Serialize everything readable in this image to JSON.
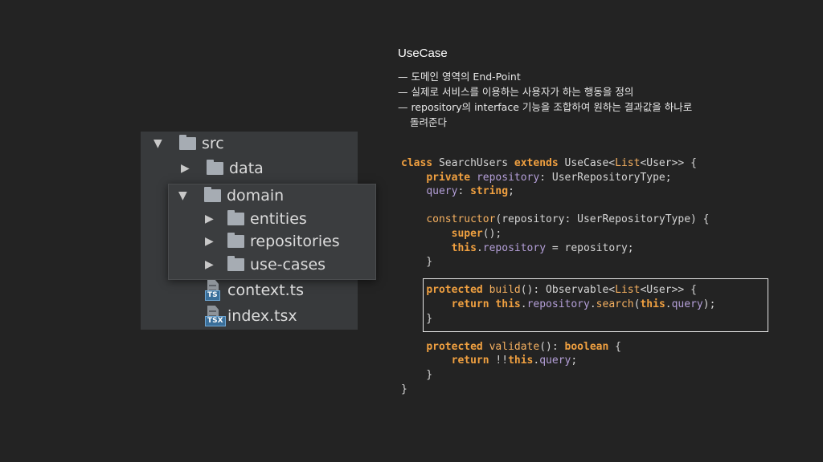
{
  "tree": {
    "items": [
      {
        "label": "src",
        "arrow": "▼",
        "icon": "folder-icon"
      },
      {
        "label": "data",
        "arrow": "▶",
        "icon": "folder-icon"
      },
      {
        "label": "domain",
        "arrow": "▼",
        "icon": "folder-icon"
      },
      {
        "label": "entities",
        "arrow": "▶",
        "icon": "folder-icon"
      },
      {
        "label": "repositories",
        "arrow": "▶",
        "icon": "folder-icon"
      },
      {
        "label": "use-cases",
        "arrow": "▶",
        "icon": "folder-icon"
      },
      {
        "label": "context.ts",
        "icon": "ts-file-icon",
        "tag": "TS"
      },
      {
        "label": "index.tsx",
        "icon": "tsx-file-icon",
        "tag": "TSX"
      }
    ]
  },
  "notes": {
    "title": "UseCase",
    "lines": [
      "— 도메인 영역의 End-Point",
      "— 실제로 서비스를 이용하는 사용자가 하는 행동을 정의",
      "— repository의 interface 기능을 조합하여 원하는 결과값을 하나로",
      "돌려준다"
    ]
  },
  "code": {
    "lines": [
      [
        [
          "kw",
          "class"
        ],
        [
          "t",
          " SearchUsers "
        ],
        [
          "kw",
          "extends"
        ],
        [
          "t",
          " UseCase<"
        ],
        [
          "fn",
          "List"
        ],
        [
          "t",
          "<User>> {"
        ]
      ],
      [
        [
          "t",
          "    "
        ],
        [
          "kw",
          "private"
        ],
        [
          "t",
          " "
        ],
        [
          "prop",
          "repository"
        ],
        [
          "t",
          ": UserRepositoryType;"
        ]
      ],
      [
        [
          "t",
          "    "
        ],
        [
          "prop",
          "query"
        ],
        [
          "t",
          ": "
        ],
        [
          "kw",
          "string"
        ],
        [
          "t",
          ";"
        ]
      ],
      [
        [
          "t",
          ""
        ]
      ],
      [
        [
          "t",
          "    "
        ],
        [
          "fn",
          "constructor"
        ],
        [
          "t",
          "(repository: UserRepositoryType) {"
        ]
      ],
      [
        [
          "t",
          "        "
        ],
        [
          "kw",
          "super"
        ],
        [
          "t",
          "();"
        ]
      ],
      [
        [
          "t",
          "        "
        ],
        [
          "kw",
          "this"
        ],
        [
          "t",
          "."
        ],
        [
          "prop",
          "repository"
        ],
        [
          "t",
          " = repository;"
        ]
      ],
      [
        [
          "t",
          "    }"
        ]
      ],
      [
        [
          "t",
          ""
        ]
      ],
      [
        [
          "t",
          "    "
        ],
        [
          "kw",
          "protected"
        ],
        [
          "t",
          " "
        ],
        [
          "fn",
          "build"
        ],
        [
          "t",
          "(): Observable<"
        ],
        [
          "fn",
          "List"
        ],
        [
          "t",
          "<User>> {"
        ]
      ],
      [
        [
          "t",
          "        "
        ],
        [
          "kw",
          "return"
        ],
        [
          "t",
          " "
        ],
        [
          "kw",
          "this"
        ],
        [
          "t",
          "."
        ],
        [
          "prop",
          "repository"
        ],
        [
          "t",
          "."
        ],
        [
          "fn",
          "search"
        ],
        [
          "t",
          "("
        ],
        [
          "kw",
          "this"
        ],
        [
          "t",
          "."
        ],
        [
          "prop",
          "query"
        ],
        [
          "t",
          ");"
        ]
      ],
      [
        [
          "t",
          "    }"
        ]
      ],
      [
        [
          "t",
          ""
        ]
      ],
      [
        [
          "t",
          "    "
        ],
        [
          "kw",
          "protected"
        ],
        [
          "t",
          " "
        ],
        [
          "fn",
          "validate"
        ],
        [
          "t",
          "(): "
        ],
        [
          "kw",
          "boolean"
        ],
        [
          "t",
          " {"
        ]
      ],
      [
        [
          "t",
          "        "
        ],
        [
          "kw",
          "return"
        ],
        [
          "t",
          " !!"
        ],
        [
          "kw",
          "this"
        ],
        [
          "t",
          "."
        ],
        [
          "prop",
          "query"
        ],
        [
          "t",
          ";"
        ]
      ],
      [
        [
          "t",
          "    }"
        ]
      ],
      [
        [
          "t",
          "}"
        ]
      ]
    ]
  },
  "colors": {
    "background": "#232323",
    "panel": "#383a3c",
    "keyword": "#f0a040",
    "property": "#b49fd8",
    "text": "#d4d4d4"
  }
}
